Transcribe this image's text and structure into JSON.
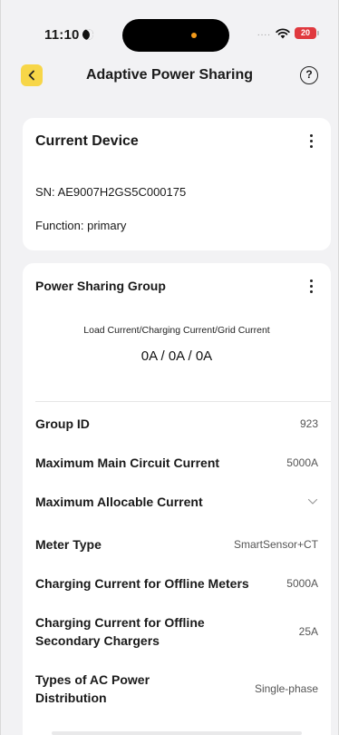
{
  "status_bar": {
    "time": "11:10",
    "battery": "20",
    "signal": "...."
  },
  "nav": {
    "title": "Adaptive Power Sharing",
    "help": "?"
  },
  "current_device": {
    "title": "Current Device",
    "sn": "SN: AE9007H2GS5C000175",
    "function": "Function: primary"
  },
  "power_sharing_group": {
    "title": "Power Sharing Group",
    "current_label": "Load Current/Charging Current/Grid Current",
    "current_value": "0A / 0A / 0A",
    "rows": [
      {
        "label": "Group ID",
        "value": "923"
      },
      {
        "label": "Maximum Main Circuit Current",
        "value": "5000A"
      },
      {
        "label": "Maximum Allocable Current",
        "value": ""
      },
      {
        "label": "Meter Type",
        "value": "SmartSensor+CT"
      },
      {
        "label": "Charging Current for Offline Meters",
        "value": "5000A"
      },
      {
        "label": "Charging Current for Offline Secondary Chargers",
        "value": "25A"
      },
      {
        "label": "Types of AC Power Distribution",
        "value": "Single-phase"
      }
    ]
  },
  "colors": {
    "accent": "#f7d648",
    "battery": "#e0393e",
    "background": "#f2f2f4"
  },
  "icons": [
    "moon-icon",
    "wifi-icon",
    "back-chevron-icon",
    "help-icon",
    "more-vertical-icon",
    "chevron-down-icon"
  ]
}
